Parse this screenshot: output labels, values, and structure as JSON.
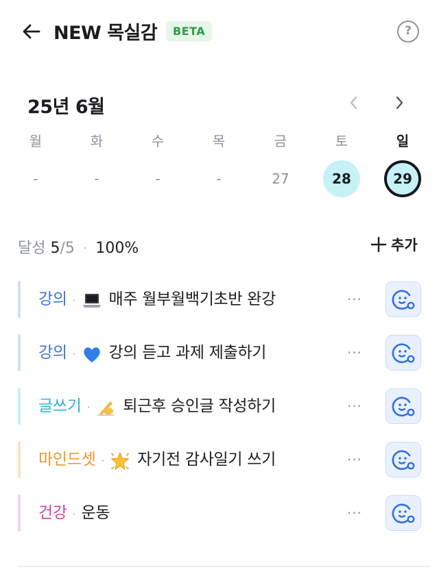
{
  "header": {
    "title": "NEW 목실감",
    "badge": "BETA",
    "help_label": "?"
  },
  "calendar": {
    "month_label": "25년 6월",
    "weekdays": [
      "월",
      "화",
      "수",
      "목",
      "금",
      "토",
      "일"
    ],
    "dates": [
      "-",
      "-",
      "-",
      "-",
      "27",
      "28",
      "29"
    ],
    "completed_dates": [
      "28"
    ],
    "today": "29"
  },
  "summary": {
    "label": "달성",
    "done": "5",
    "slash": "/",
    "total": "5",
    "separator": "·",
    "percent": "100%"
  },
  "add_button": {
    "icon": "plus-icon",
    "label": "추가"
  },
  "tasks": [
    {
      "category": "강의",
      "category_color": "#3d75d6",
      "bar_color": "#cfe0fb",
      "separator": "·",
      "emoji": "laptop",
      "text": "매주 월부월백기초반 완강",
      "more": "···"
    },
    {
      "category": "강의",
      "category_color": "#3d75d6",
      "bar_color": "#cfe0fb",
      "separator": "·",
      "emoji": "blue-heart",
      "text": "강의 듣고 과제 제출하기",
      "more": "···"
    },
    {
      "category": "글쓰기",
      "category_color": "#2eb3d6",
      "bar_color": "#c9eef6",
      "separator": "·",
      "emoji": "writing-hand",
      "text": "퇴근후 승인글 작성하기",
      "more": "···"
    },
    {
      "category": "마인드셋",
      "category_color": "#f0962b",
      "bar_color": "#fde2c2",
      "separator": "·",
      "emoji": "glowing-star",
      "text": "자기전 감사일기 쓰기",
      "more": "···"
    },
    {
      "category": "건강",
      "category_color": "#d4429a",
      "bar_color": "#f8cfe6",
      "separator": "·",
      "emoji": "",
      "text": "운동",
      "more": "···"
    }
  ],
  "colors": {
    "accent_cyan": "#c6f1f5",
    "beta_bg": "#e6f6e9",
    "beta_text": "#2e9a48",
    "check_bg": "#e9f1ff",
    "check_icon": "#2f6fe0"
  }
}
